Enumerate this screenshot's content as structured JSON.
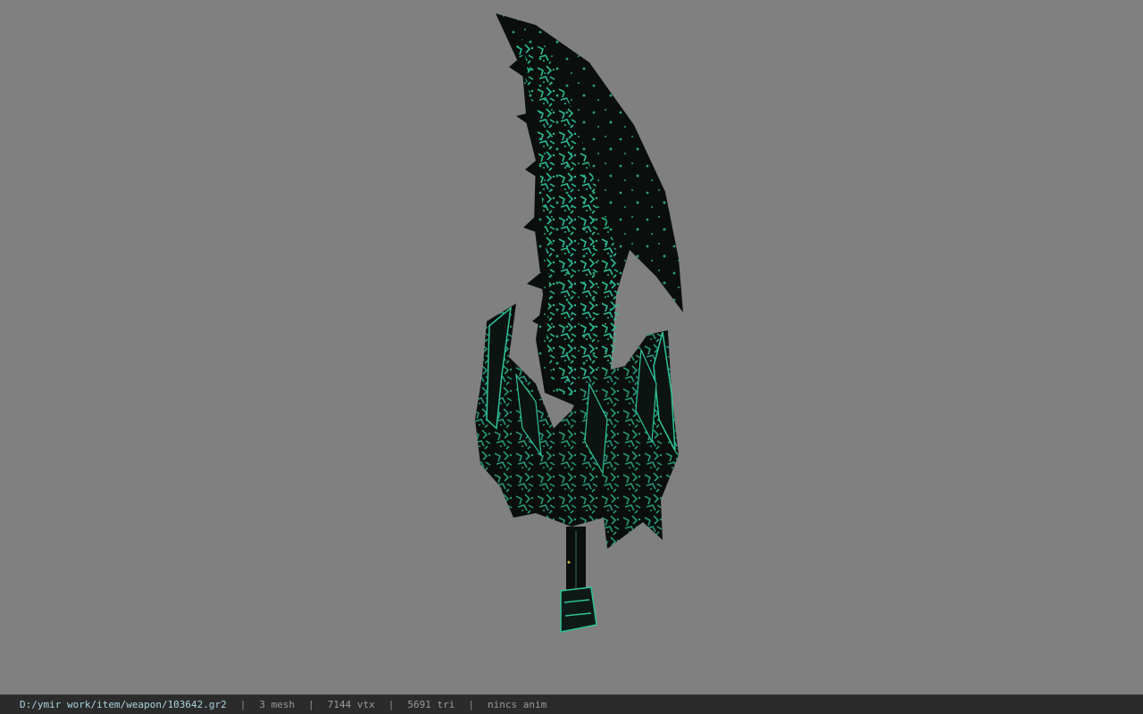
{
  "viewport": {
    "background": "#808080",
    "model": "weapon-sword-mesh",
    "model_colors": {
      "body": "#0a0f0d",
      "glow": "#2fc39a"
    }
  },
  "statusbar": {
    "file_path": "D:/ymir work/item/weapon/103642.gr2",
    "separator": "|",
    "mesh_count": "3 mesh",
    "vertex_count": "7144 vtx",
    "triangle_count": "5691 tri",
    "anim_status": "nincs anim"
  }
}
